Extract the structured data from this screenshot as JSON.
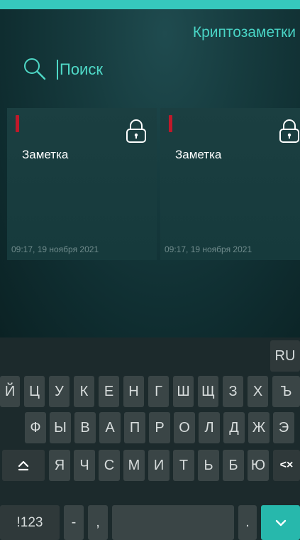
{
  "app": {
    "title": "Криптозаметки",
    "accent_color": "#36c8bd"
  },
  "search": {
    "placeholder": "Поиск",
    "value": "",
    "icon": "search-icon"
  },
  "notes": [
    {
      "title": "Заметка",
      "date": "09:17, 19 ноября 2021",
      "locked": true,
      "marker_color": "#c0192a"
    },
    {
      "title": "Заметка",
      "date": "09:17, 19 ноября 2021",
      "locked": true,
      "marker_color": "#c0192a"
    }
  ],
  "keyboard": {
    "lang_key": "RU",
    "row1": [
      "Й",
      "Ц",
      "У",
      "К",
      "Е",
      "Н",
      "Г",
      "Ш",
      "Щ",
      "З",
      "Х",
      "Ъ"
    ],
    "row2": [
      "Ф",
      "Ы",
      "В",
      "А",
      "П",
      "Р",
      "О",
      "Л",
      "Д",
      "Ж",
      "Э"
    ],
    "row3": [
      "Я",
      "Ч",
      "С",
      "М",
      "И",
      "Т",
      "Ь",
      "Б",
      "Ю"
    ],
    "shift_icon": "shift-icon",
    "backspace_label": "<×",
    "symbols_key": "!123",
    "dash_key": "-",
    "comma_key": ",",
    "period_key": ".",
    "enter_icon": "chevron-down-icon"
  }
}
